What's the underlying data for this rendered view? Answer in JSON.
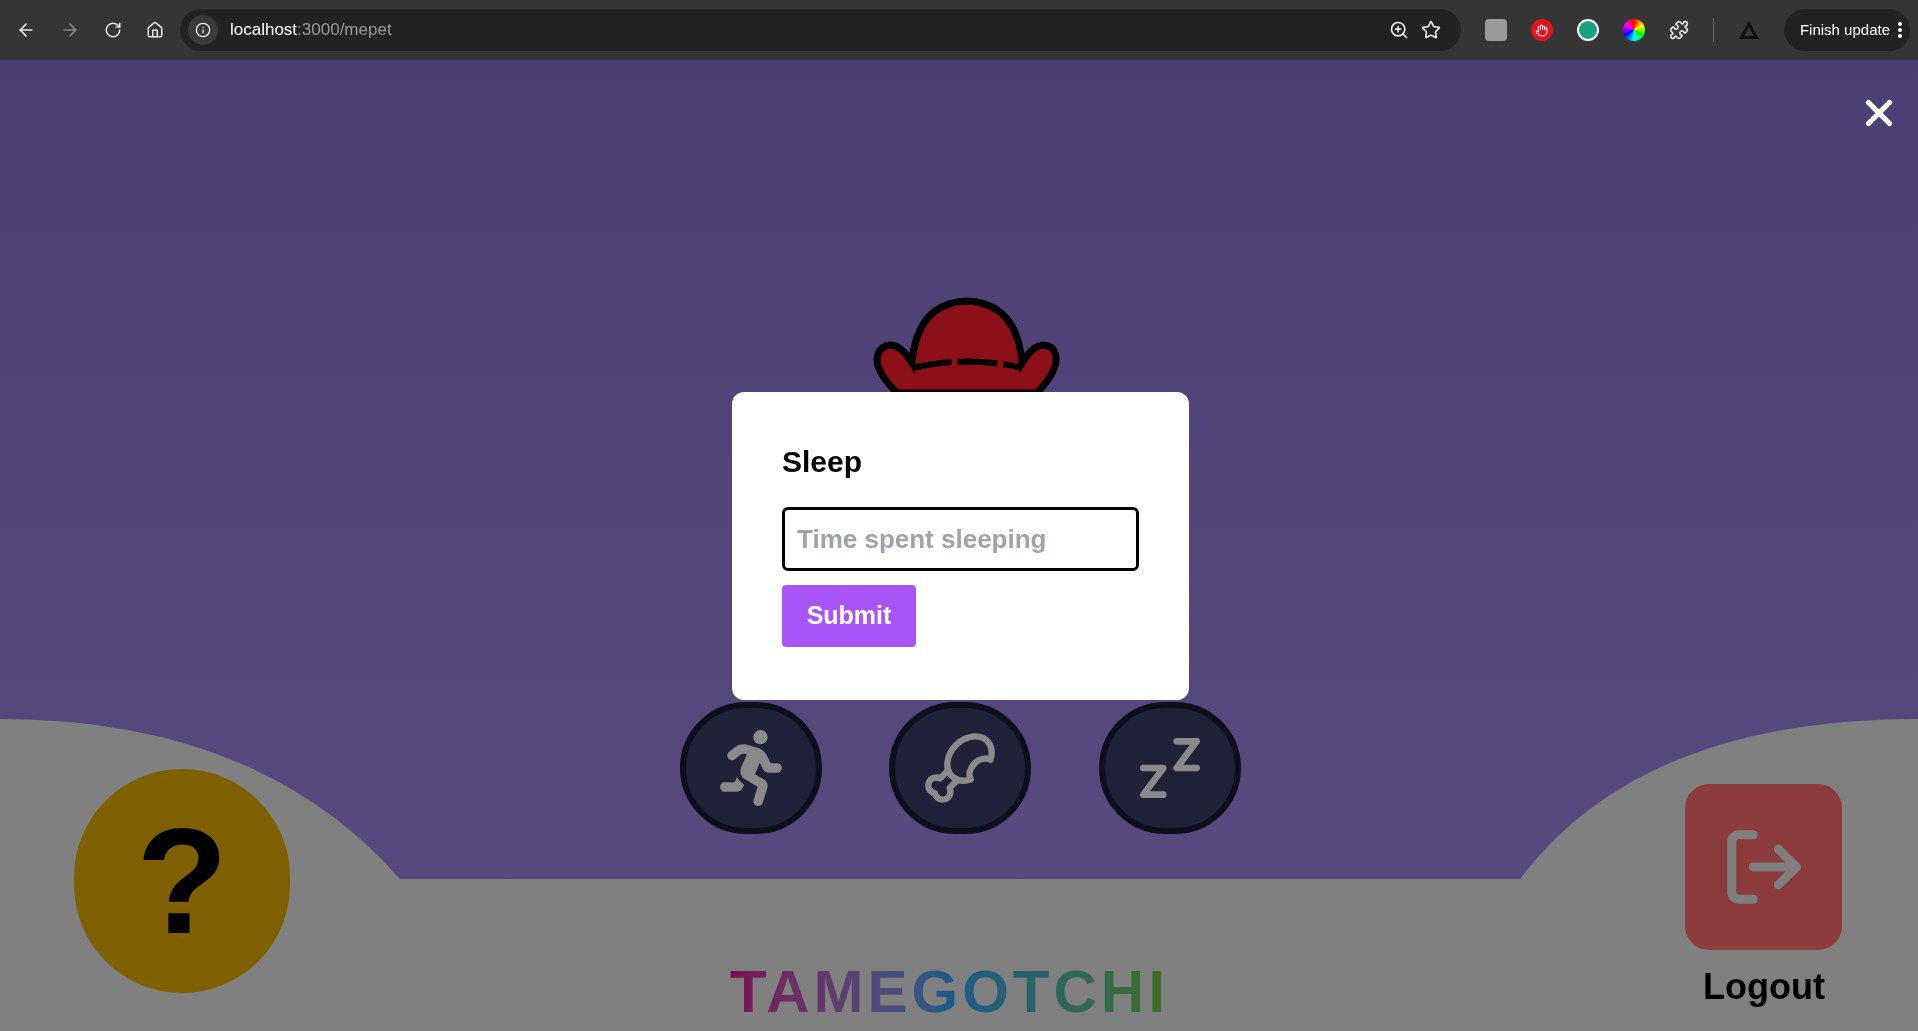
{
  "browser": {
    "url_host": "localhost",
    "url_path": ":3000/mepet",
    "update_button": "Finish update"
  },
  "dialog": {
    "title": "Sleep",
    "input": {
      "placeholder": "Time spent sleeping"
    },
    "submit": "Submit"
  },
  "help_button": "?",
  "logout": {
    "label": "Logout"
  },
  "logo": "TAMEGOTCHI"
}
